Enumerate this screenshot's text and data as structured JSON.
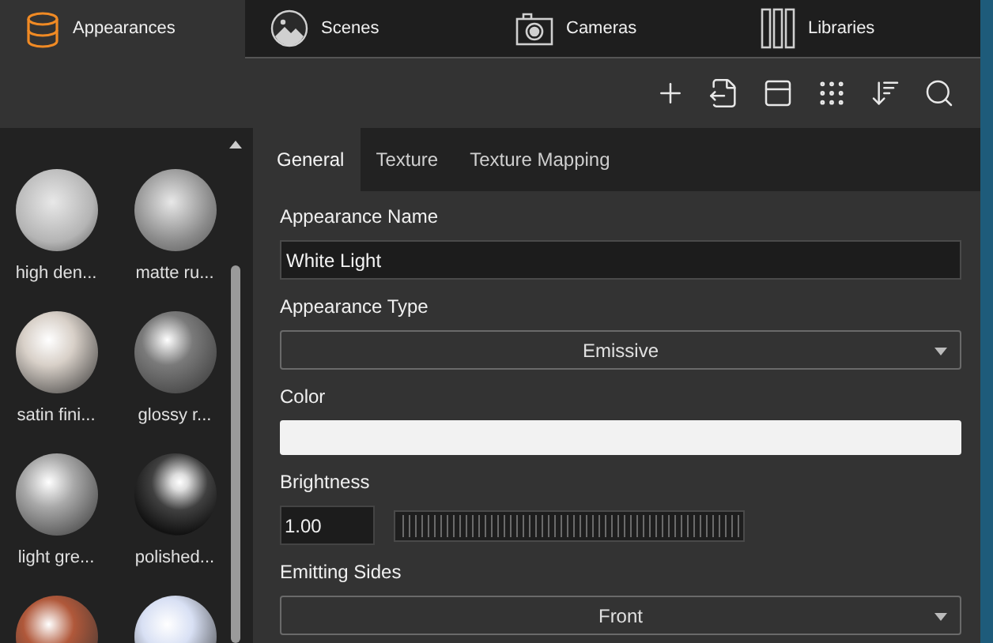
{
  "main_tabs": [
    {
      "label": "Appearances",
      "selected": true,
      "kind": "bucket"
    },
    {
      "label": "Scenes",
      "selected": false,
      "kind": "landscape"
    },
    {
      "label": "Cameras",
      "selected": false,
      "kind": "camera"
    },
    {
      "label": "Libraries",
      "selected": false,
      "kind": "books"
    }
  ],
  "materials": [
    {
      "label": "high den...",
      "color": "#b4b4b4",
      "kind": "matte"
    },
    {
      "label": "matte ru...",
      "color": "#8a8a8a",
      "kind": "matte"
    },
    {
      "label": "satin fini...",
      "color": "#d8d0c8",
      "kind": "glossy"
    },
    {
      "label": "glossy r...",
      "color": "#7a7a7a",
      "kind": "glossy"
    },
    {
      "label": "light gre...",
      "color": "#a8a8a8",
      "kind": "glossy"
    },
    {
      "label": "polished...",
      "color": "#404040",
      "kind": "chrome"
    },
    {
      "color": "#b0583a",
      "kind": "glossy"
    },
    {
      "color": "#d8e0f4",
      "kind": "glossy"
    }
  ],
  "editor_tabs": [
    {
      "label": "General",
      "selected": true
    },
    {
      "label": "Texture",
      "selected": false
    },
    {
      "label": "Texture Mapping",
      "selected": false
    }
  ],
  "fields": [
    {
      "kind": "text",
      "label": "Appearance Name",
      "value": "White Light"
    },
    {
      "kind": "select",
      "label": "Appearance Type",
      "value": "Emissive"
    },
    {
      "kind": "color",
      "label": "Color",
      "color": "#f2f2f2"
    },
    {
      "kind": "slider",
      "label": "Brightness",
      "value": "1.00"
    },
    {
      "kind": "select",
      "label": "Emitting Sides",
      "value": "Front"
    }
  ]
}
